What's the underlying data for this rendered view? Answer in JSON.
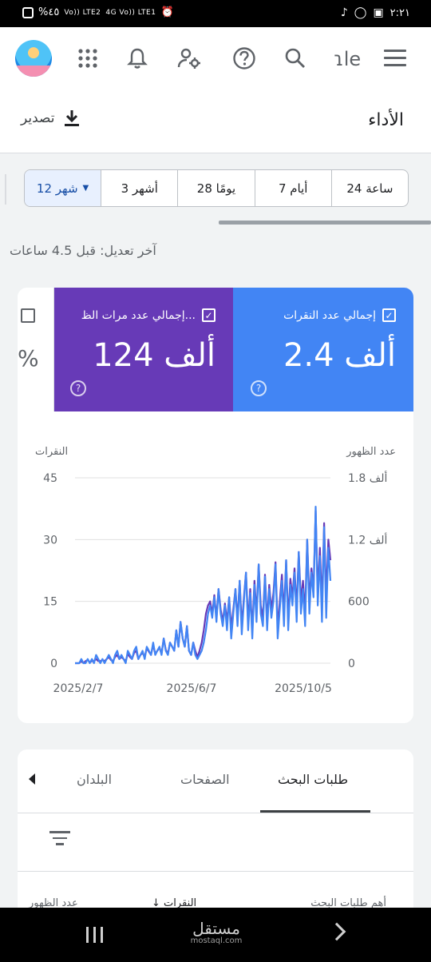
{
  "status_bar": {
    "left_text": "%٤٥",
    "network_1": "Vo)) LTE2",
    "network_2": "4G Vo)) LTE1",
    "clock": "٢:٢١"
  },
  "app_bar": {
    "brand_fragment": "ɿle",
    "icons": [
      "avatar",
      "apps-grid-icon",
      "bell-icon",
      "account-settings-icon",
      "help-icon",
      "search-icon",
      "menu-icon"
    ]
  },
  "header": {
    "title": "الأداء",
    "export_label": "تصدير"
  },
  "ranges": [
    {
      "label": "24 ساعة",
      "selected": false
    },
    {
      "label": "7 أيام",
      "selected": false
    },
    {
      "label": "28 يومًا",
      "selected": false
    },
    {
      "label": "3 أشهر",
      "selected": false
    },
    {
      "label": "12 شهر",
      "selected": true
    }
  ],
  "last_updated": "آخر تعديل: قبل 4.5 ساعات",
  "metrics": {
    "clicks": {
      "label": "إجمالي عدد النقرات",
      "value": "2.4 ألف",
      "color": "#4285f4"
    },
    "impressions": {
      "label": "إجمالي عدد مرات الظ...",
      "value": "124 ألف",
      "color": "#673ab7"
    },
    "ctr": {
      "symbol": "%"
    }
  },
  "chart_data": {
    "type": "line",
    "left_axis_title": "النقرات",
    "right_axis_title": "عدد الظهور",
    "left_ticks": [
      "45",
      "30",
      "15",
      "0"
    ],
    "right_ticks": [
      "1.8 ألف",
      "1.2 ألف",
      "600",
      "0"
    ],
    "x_ticks": [
      "2025/2/7",
      "2025/6/7",
      "2025/10/5"
    ],
    "left_ylim": [
      0,
      45
    ],
    "right_ylim": [
      0,
      1800
    ],
    "grid": true,
    "series": [
      {
        "name": "إجمالي عدد النقرات",
        "axis": "left",
        "color": "#4285f4",
        "values": [
          0,
          0,
          0,
          1,
          0,
          0,
          1,
          0,
          1,
          0,
          2,
          1,
          0,
          1,
          0,
          1,
          2,
          1,
          0,
          2,
          3,
          1,
          2,
          1,
          0,
          3,
          2,
          1,
          3,
          4,
          1,
          2,
          3,
          1,
          4,
          3,
          2,
          5,
          2,
          3,
          4,
          2,
          6,
          3,
          2,
          5,
          4,
          3,
          8,
          4,
          10,
          6,
          4,
          9,
          3,
          2,
          5,
          2,
          1,
          2,
          3,
          5,
          8,
          12,
          14,
          11,
          16,
          10,
          18,
          12,
          9,
          14,
          8,
          16,
          6,
          12,
          18,
          9,
          20,
          7,
          15,
          22,
          8,
          17,
          6,
          19,
          10,
          24,
          12,
          9,
          21,
          8,
          18,
          11,
          15,
          24,
          6,
          13,
          20,
          9,
          25,
          8,
          19,
          14,
          22,
          10,
          27,
          12,
          18,
          9,
          30,
          12,
          22,
          16,
          38,
          14,
          26,
          10,
          33,
          11,
          28,
          20
        ]
      },
      {
        "name": "إجمالي عدد مرات الظهور",
        "axis": "right",
        "color": "#673ab7",
        "values": [
          0,
          0,
          0,
          20,
          0,
          20,
          30,
          10,
          20,
          20,
          40,
          20,
          20,
          30,
          20,
          40,
          60,
          30,
          20,
          60,
          80,
          40,
          60,
          40,
          20,
          90,
          60,
          40,
          100,
          120,
          40,
          80,
          100,
          60,
          150,
          110,
          80,
          180,
          90,
          120,
          150,
          90,
          240,
          130,
          90,
          200,
          160,
          120,
          320,
          160,
          400,
          240,
          160,
          360,
          120,
          80,
          200,
          120,
          60,
          120,
          200,
          320,
          480,
          560,
          600,
          480,
          660,
          440,
          720,
          520,
          400,
          580,
          400,
          640,
          340,
          520,
          720,
          420,
          800,
          360,
          640,
          880,
          400,
          720,
          320,
          800,
          480,
          960,
          560,
          440,
          860,
          400,
          760,
          520,
          680,
          980,
          340,
          600,
          860,
          480,
          1000,
          420,
          820,
          640,
          920,
          520,
          1080,
          600,
          800,
          480,
          1200,
          600,
          920,
          720,
          1480,
          680,
          1120,
          560,
          1360,
          640,
          1200,
          1000
        ]
      }
    ]
  },
  "tabs": [
    {
      "label": "طلبات البحث",
      "active": true
    },
    {
      "label": "الصفحات",
      "active": false
    },
    {
      "label": "البلدان",
      "active": false
    }
  ],
  "table_headers": {
    "top_queries": "أهم طلبات البحث",
    "clicks": "النقرات",
    "impressions": "عدد الظهور"
  },
  "nav_bar": {
    "watermark": "مستقل",
    "watermark_sub": "mostaql.com"
  }
}
